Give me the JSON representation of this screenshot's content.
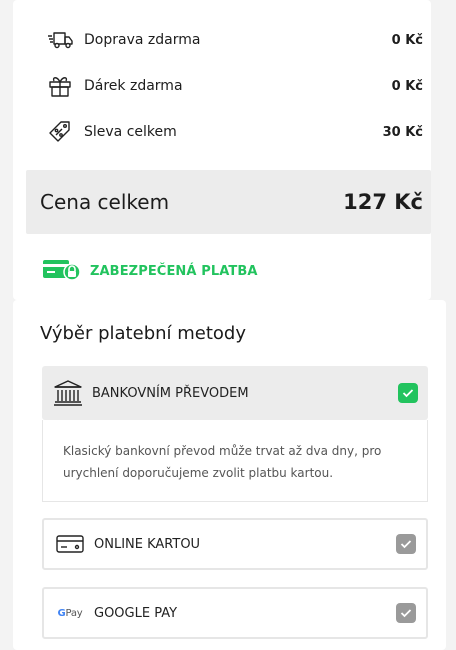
{
  "summary": {
    "rows": [
      {
        "label": "Doprava zdarma",
        "value": "0 Kč",
        "icon": "truck-icon"
      },
      {
        "label": "Dárek zdarma",
        "value": "0 Kč",
        "icon": "gift-icon"
      },
      {
        "label": "Sleva celkem",
        "value": "30 Kč",
        "icon": "discount-tag-icon"
      }
    ],
    "total_label": "Cena celkem",
    "total_value": "127 Kč"
  },
  "secure": {
    "label": "ZABEZPEČENÁ PLATBA",
    "color": "#22c35e"
  },
  "payment": {
    "title": "Výběr platební metody",
    "methods": [
      {
        "label": "BANKOVNÍM PŘEVODEM",
        "icon": "bank-icon",
        "selected": true,
        "description": "Klasický bankovní převod může trvat až dva dny, pro urychlení doporučujeme zvolit platbu kartou."
      },
      {
        "label": "ONLINE KARTOU",
        "icon": "credit-card-icon",
        "selected": false
      },
      {
        "label": "GOOGLE PAY",
        "icon": "google-pay-icon",
        "icon_text": "Pay",
        "icon_letter": "G",
        "selected": false
      }
    ]
  }
}
